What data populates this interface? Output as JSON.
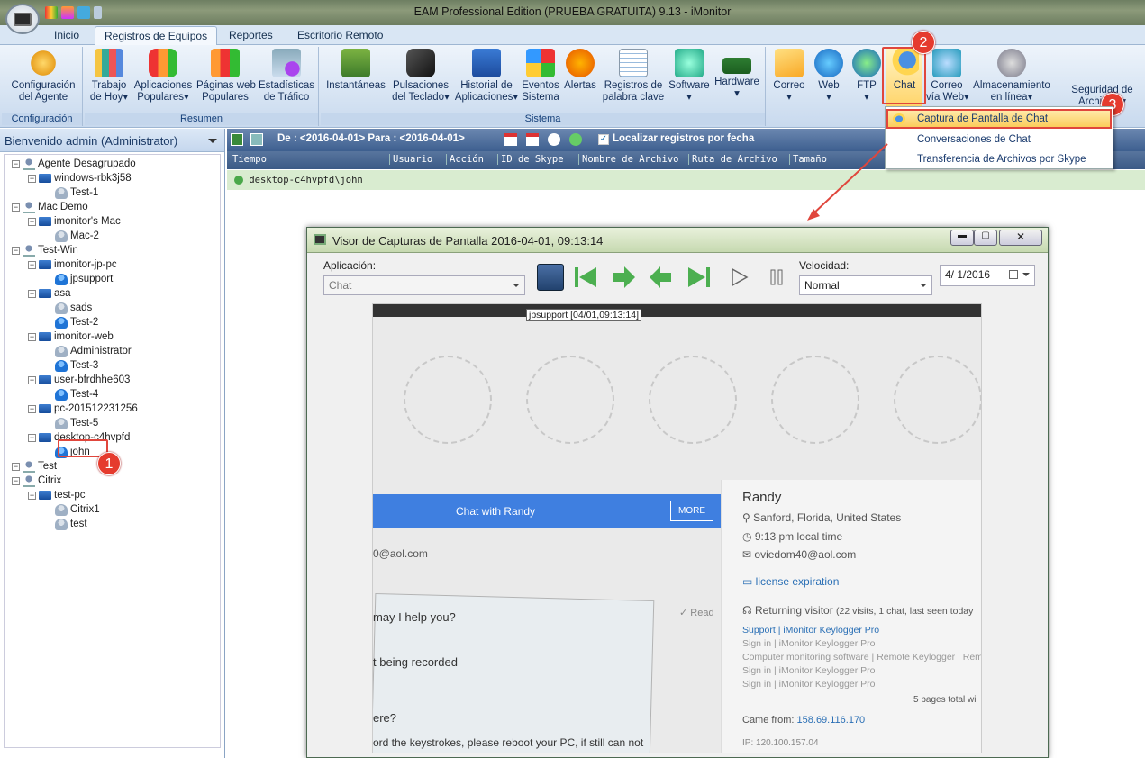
{
  "window": {
    "title": "EAM Professional Edition (PRUEBA GRATUITA) 9.13 - iMonitor"
  },
  "tabs": [
    "Inicio",
    "Registros de Equipos",
    "Reportes",
    "Escritorio Remoto"
  ],
  "active_tab": "Registros de Equipos",
  "ribbon": {
    "config": {
      "btn": [
        "Configuración",
        "del Agente"
      ],
      "group": "Configuración"
    },
    "resumen": {
      "group": "Resumen",
      "buttons": [
        [
          "Trabajo",
          "de Hoy"
        ],
        [
          "Aplicaciones",
          "Populares"
        ],
        [
          "Páginas web",
          "Populares"
        ],
        [
          "Estadísticas",
          "de Tráfico"
        ]
      ]
    },
    "sistema": {
      "group": "Sistema",
      "buttons": [
        [
          "Instantáneas",
          ""
        ],
        [
          "Pulsaciones",
          "del Teclado"
        ],
        [
          "Historial de",
          "Aplicaciones"
        ],
        [
          "Eventos",
          "Sistema"
        ],
        [
          "Alertas",
          ""
        ],
        [
          "Registros de",
          "palabra clave"
        ],
        [
          "Software",
          ""
        ],
        [
          "Hardware",
          ""
        ]
      ]
    },
    "comms": {
      "buttons": [
        [
          "Correo",
          ""
        ],
        [
          "Web",
          ""
        ],
        [
          "FTP",
          ""
        ],
        [
          "Chat",
          ""
        ],
        [
          "Correo",
          "vía Web"
        ],
        [
          "Almacenamiento",
          "en línea"
        ],
        [
          "Seguridad de",
          "Archivos"
        ]
      ]
    }
  },
  "chat_menu": [
    "Captura de Pantalla de Chat",
    "Conversaciones de Chat",
    "Transferencia de Archivos por Skype"
  ],
  "left": {
    "header": "Bienvenido admin (Administrator)",
    "tree": [
      "Agente Desagrupado",
      "windows-rbk3j58",
      "Test-1",
      "Mac Demo",
      "imonitor's Mac",
      "Mac-2",
      "Test-Win",
      "imonitor-jp-pc",
      "jpsupport",
      "asa",
      "sads",
      "Test-2",
      "imonitor-web",
      "Administrator",
      "Test-3",
      "user-bfrdhhe603",
      "Test-4",
      "pc-201512231256",
      "Test-5",
      "desktop-c4hvpfd",
      "john",
      "Test",
      "Citrix",
      "test-pc",
      "Citrix1",
      "test"
    ]
  },
  "toolbar": {
    "range": "De : <2016-04-01> Para : <2016-04-01>",
    "locate": "Localizar registros por fecha"
  },
  "columns": [
    "Tiempo",
    "Usuario",
    "Acción",
    "ID de Skype",
    "Nombre de Archivo",
    "Ruta de Archivo",
    "Tamaño"
  ],
  "row": "desktop-c4hvpfd\\john",
  "badges": [
    "1",
    "2",
    "3"
  ],
  "viewer": {
    "title": "Visor de Capturas de Pantalla 2016-04-01, 09:13:14",
    "app_label": "Aplicación:",
    "app_value": "Chat",
    "speed_label": "Velocidad:",
    "speed_value": "Normal",
    "date_value": "4/  1/2016",
    "shot_label": "jpsupport [04/01,09:13:14]",
    "chat_title": "Chat with Randy",
    "more": "MORE",
    "email_partial": "0@aol.com",
    "read": "✓ Read",
    "line1": "may I help you?",
    "line2": "t being recorded",
    "line3": "ere?",
    "line4": "ord the keystrokes, please reboot your PC, if still can not",
    "name": "Randy",
    "location": "Sanford, Florida, United States",
    "local_time": "9:13 pm local time",
    "email": "oviedom40@aol.com",
    "license": "license expiration",
    "returning": "Returning visitor",
    "visits": "(22 visits, 1 chat, last seen today",
    "links": [
      "Support | iMonitor Keylogger Pro",
      "Sign in | iMonitor Keylogger Pro",
      "Computer monitoring software | Remote Keylogger | Remo",
      "Sign in | iMonitor Keylogger Pro",
      "Sign in | iMonitor Keylogger Pro"
    ],
    "pages": "5 pages total wi",
    "came_from": "Came from:",
    "ip": "158.69.116.170",
    "ip2": "IP: 120.100.157.04"
  }
}
